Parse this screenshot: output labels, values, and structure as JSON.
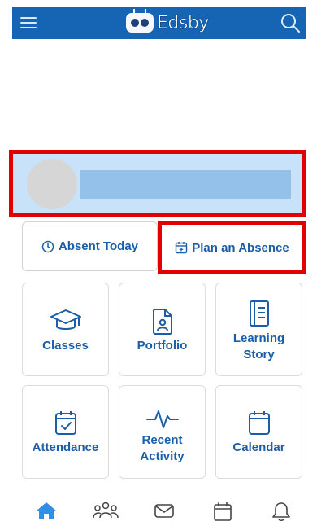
{
  "header": {
    "app_name": "Edsby",
    "menu_icon": "hamburger-menu-icon",
    "search_icon": "search-icon",
    "bar_color": "#1565b4"
  },
  "profile": {
    "avatar_icon": "avatar",
    "highlight_color": "#e00000",
    "background_color": "#c8e2fa"
  },
  "actions": {
    "absent_today": "Absent Today",
    "plan_absence": "Plan an Absence"
  },
  "tiles": [
    {
      "label": "Classes",
      "icon": "graduation-cap-icon"
    },
    {
      "label": "Portfolio",
      "icon": "portfolio-document-icon"
    },
    {
      "label": "Learning Story",
      "icon": "book-icon"
    },
    {
      "label": "Attendance",
      "icon": "calendar-check-icon"
    },
    {
      "label": "Recent Activity",
      "icon": "activity-pulse-icon"
    },
    {
      "label": "Calendar",
      "icon": "calendar-icon"
    }
  ],
  "tabbar": {
    "items": [
      "home-icon",
      "people-icon",
      "mail-icon",
      "calendar-icon",
      "bell-icon"
    ],
    "active": "home-icon",
    "accent_color": "#1e88e5"
  }
}
